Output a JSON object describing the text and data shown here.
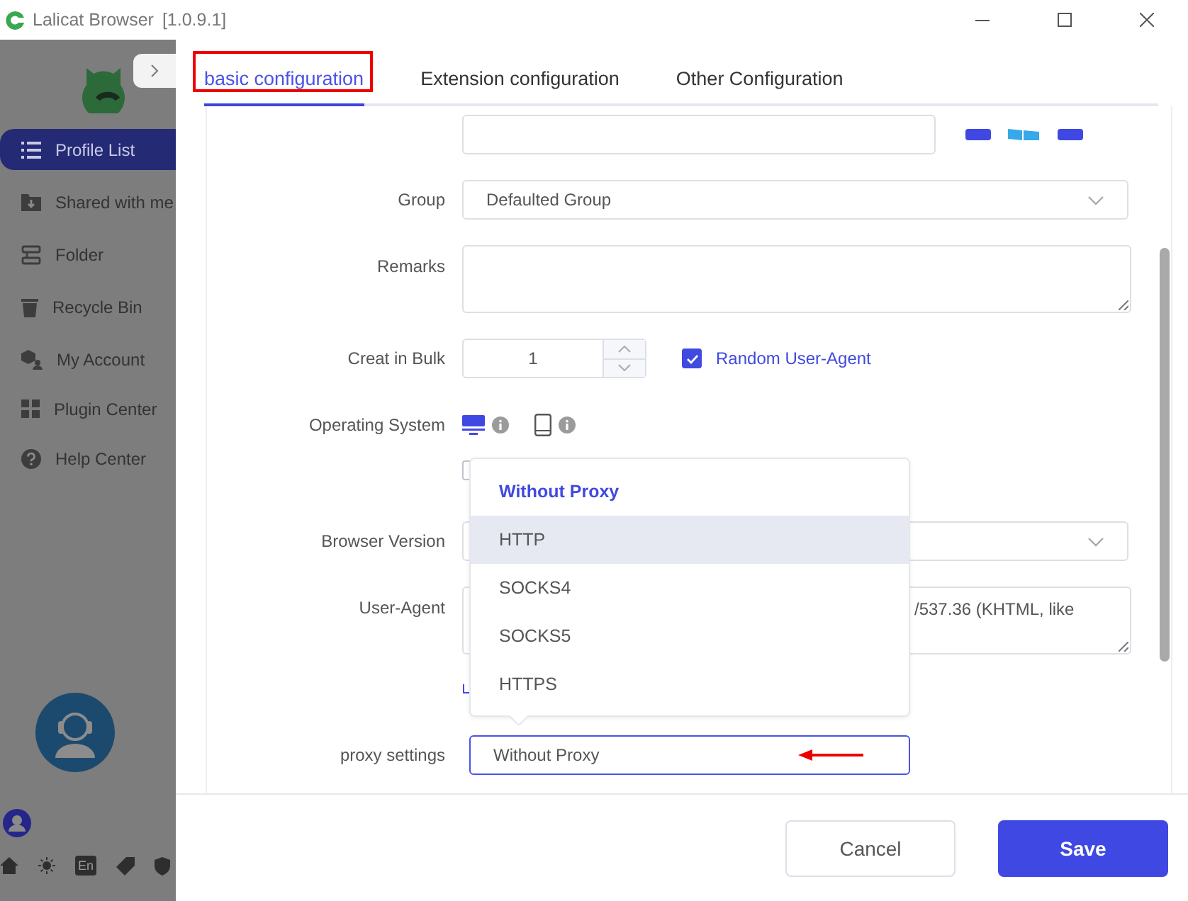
{
  "window": {
    "title": "Lalicat Browser",
    "version": "[1.0.9.1]"
  },
  "sidebar": {
    "items": [
      {
        "label": "Profile List",
        "selected": true
      },
      {
        "label": "Shared with me",
        "selected": false
      },
      {
        "label": "Folder",
        "selected": false
      },
      {
        "label": "Recycle Bin",
        "selected": false
      },
      {
        "label": "My Account",
        "selected": false
      },
      {
        "label": "Plugin Center",
        "selected": false
      },
      {
        "label": "Help Center",
        "selected": false
      }
    ],
    "language": "En"
  },
  "tabs": [
    {
      "label": "basic configuration",
      "selected": true
    },
    {
      "label": "Extension configuration",
      "selected": false
    },
    {
      "label": "Other Configuration",
      "selected": false
    }
  ],
  "form": {
    "group": {
      "label": "Group",
      "value": "Defaulted Group"
    },
    "remarks": {
      "label": "Remarks"
    },
    "bulk": {
      "label": "Creat in Bulk",
      "value": "1"
    },
    "random_ua": {
      "label": "Random User-Agent",
      "checked": true
    },
    "os_checkbox": {
      "checked": false
    },
    "os": {
      "label": "Operating System",
      "options": [
        {
          "kind": "desktop",
          "selected": true
        },
        {
          "kind": "mobile",
          "selected": false
        }
      ]
    },
    "browser_version": {
      "label": "Browser Version"
    },
    "user_agent": {
      "label": "User-Agent",
      "value": "/537.36 (KHTML, like"
    },
    "proxy": {
      "label": "proxy settings",
      "value": "Without Proxy",
      "options": [
        {
          "label": "Without Proxy",
          "selected": true,
          "hovered": false
        },
        {
          "label": "HTTP",
          "selected": false,
          "hovered": true
        },
        {
          "label": "SOCKS4",
          "selected": false,
          "hovered": false
        },
        {
          "label": "SOCKS5",
          "selected": false,
          "hovered": false
        },
        {
          "label": "HTTPS",
          "selected": false,
          "hovered": false
        }
      ]
    }
  },
  "buttons": [
    {
      "label": "Cancel",
      "kind": "secondary"
    },
    {
      "label": "Save",
      "kind": "primary"
    }
  ]
}
